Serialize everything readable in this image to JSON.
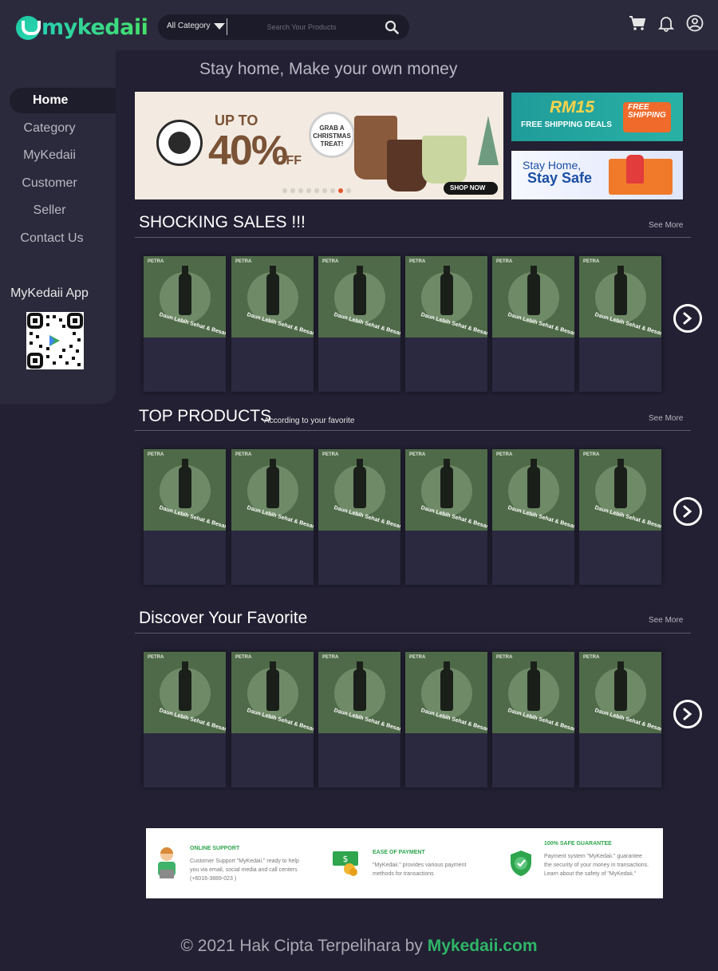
{
  "header": {
    "logo_text": "mykedaii",
    "category_label": "All Category",
    "search_placeholder": "Search Your Products"
  },
  "sidebar": {
    "items": [
      {
        "label": "Home",
        "active": true
      },
      {
        "label": "Category",
        "active": false
      },
      {
        "label": "MyKedaii",
        "active": false
      },
      {
        "label": "Customer",
        "active": false
      },
      {
        "label": "Seller",
        "active": false
      },
      {
        "label": "Contact Us",
        "active": false
      }
    ],
    "app_label": "MyKedaii App"
  },
  "tagline": "Stay home, Make your own money",
  "banners": {
    "main": {
      "upto": "UP TO",
      "percent": "40%",
      "off": "OFF",
      "badge": "GRAB A CHRISTMAS TREAT!",
      "cta": "SHOP NOW",
      "slides": 9,
      "active_slide": 8
    },
    "side1": {
      "amount": "RM15",
      "subtitle": "FREE SHIPPING DEALS",
      "tag": "FREE SHIPPING"
    },
    "side2": {
      "line1": "Stay Home,",
      "line2": "Stay Safe"
    }
  },
  "sections": [
    {
      "title": "SHOCKING SALES !!!",
      "subtitle": "",
      "see_more": "See More"
    },
    {
      "title": "TOP PRODUCTS",
      "subtitle": "According to your favorite",
      "see_more": "See More"
    },
    {
      "title": "Discover Your Favorite",
      "subtitle": "",
      "see_more": "See More"
    }
  ],
  "product": {
    "brand": "PETRA",
    "caption": "Daun Lebih Sehat & Besar"
  },
  "features": [
    {
      "title": "ONLINE SUPPORT",
      "desc": "Customer Support \"MyKedaii.\" ready to help you via email, social media and call centers (+6016-3889-023 )"
    },
    {
      "title": "EASE OF PAYMENT",
      "desc": "\"MyKedaii.\" provides various payment methods for transactions"
    },
    {
      "title": "100% SAFE GUARANTEE",
      "desc": "Payment system \"MyKedaii.\" guarantee the security of your money in transactions. Learn about the safety of \"MyKedaii.\""
    }
  ],
  "footer": {
    "text": "© 2021 Hak Cipta Terpelihara by",
    "brand": "Mykedaii.com"
  },
  "colors": {
    "accent": "#2fb568",
    "background": "#222032",
    "panel": "#2b2a3c"
  }
}
